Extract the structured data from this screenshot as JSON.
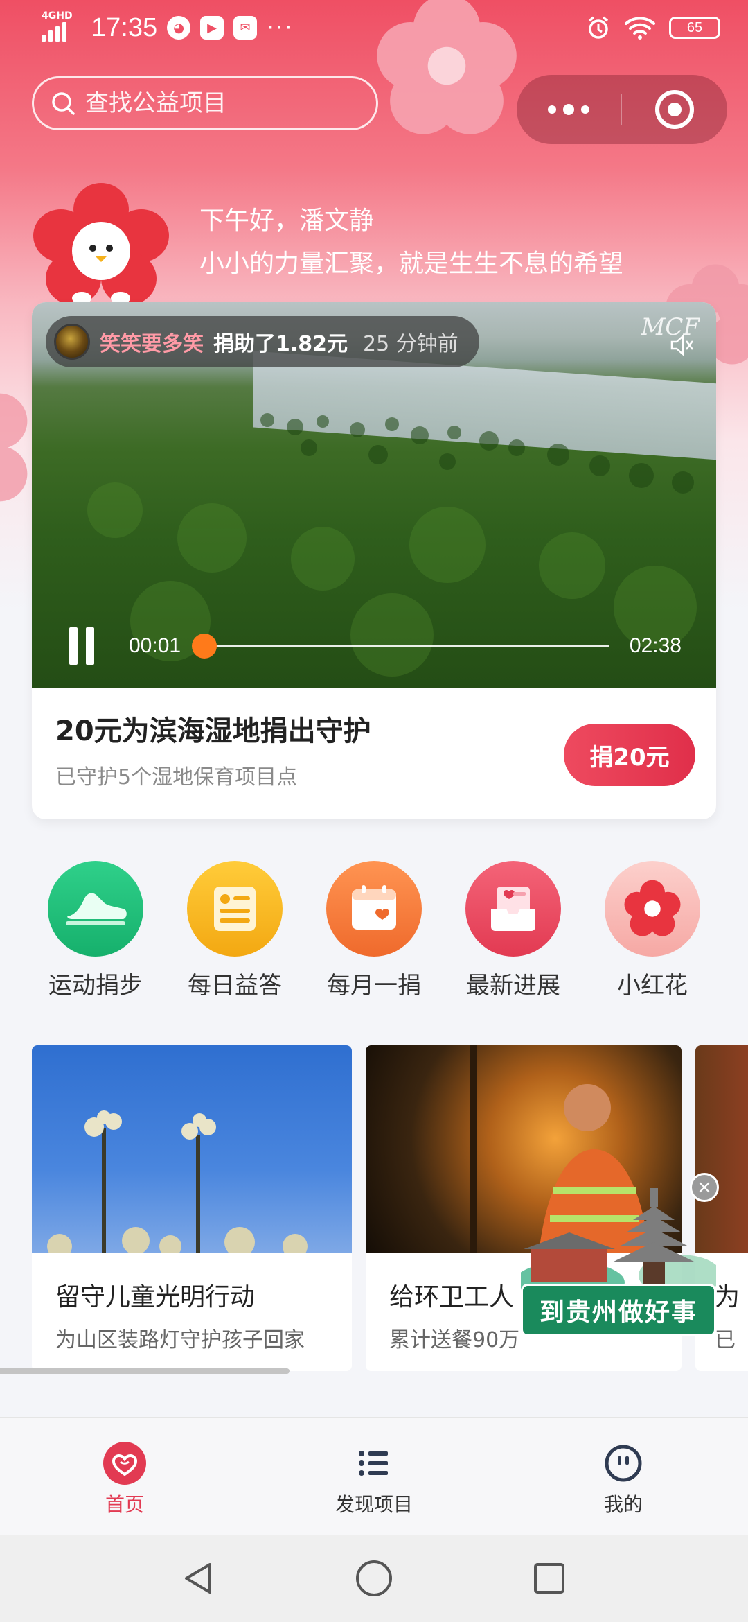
{
  "status_bar": {
    "network": "4GHD",
    "time": "17:35",
    "battery": "65"
  },
  "search": {
    "placeholder": "查找公益项目"
  },
  "greeting": {
    "line1": "下午好，潘文静",
    "line2": "小小的力量汇聚，就是生生不息的希望"
  },
  "video_card": {
    "donor_name": "笑笑要多笑",
    "donor_action": "捐助了1.82元",
    "donor_time": "25 分钟前",
    "logo_text": "MCF",
    "current_time": "00:01",
    "total_time": "02:38",
    "progress": 0.0065,
    "title": "20元为滨海湿地捐出守护",
    "subtitle": "已守护5个湿地保育项目点",
    "donate_label": "捐20元"
  },
  "shortcuts": [
    {
      "label": "运动捐步",
      "icon": "sneaker-icon",
      "color": "#1fbf7a"
    },
    {
      "label": "每日益答",
      "icon": "quiz-card-icon",
      "color": "#f6b21c"
    },
    {
      "label": "每月一捐",
      "icon": "calendar-icon",
      "color": "#f47a3a"
    },
    {
      "label": "最新进展",
      "icon": "inbox-icon",
      "color": "#ea4b60"
    },
    {
      "label": "小红花",
      "icon": "red-flower-icon",
      "color": "#f8b9b6"
    }
  ],
  "projects": [
    {
      "title": "留守儿童光明行动",
      "subtitle": "为山区装路灯守护孩子回家"
    },
    {
      "title": "给环卫工人",
      "subtitle": "累计送餐90万"
    },
    {
      "title": "为",
      "subtitle": "已"
    }
  ],
  "floating_ad": {
    "label": "到贵州做好事",
    "close": "×"
  },
  "tabbar": [
    {
      "label": "首页",
      "icon": "heart-home-icon",
      "active": true
    },
    {
      "label": "发现项目",
      "icon": "list-icon",
      "active": false
    },
    {
      "label": "我的",
      "icon": "profile-icon",
      "active": false
    }
  ],
  "colors": {
    "accent": "#e23a52",
    "hero_top": "#ef4f64",
    "progress": "#ff7a1a"
  }
}
